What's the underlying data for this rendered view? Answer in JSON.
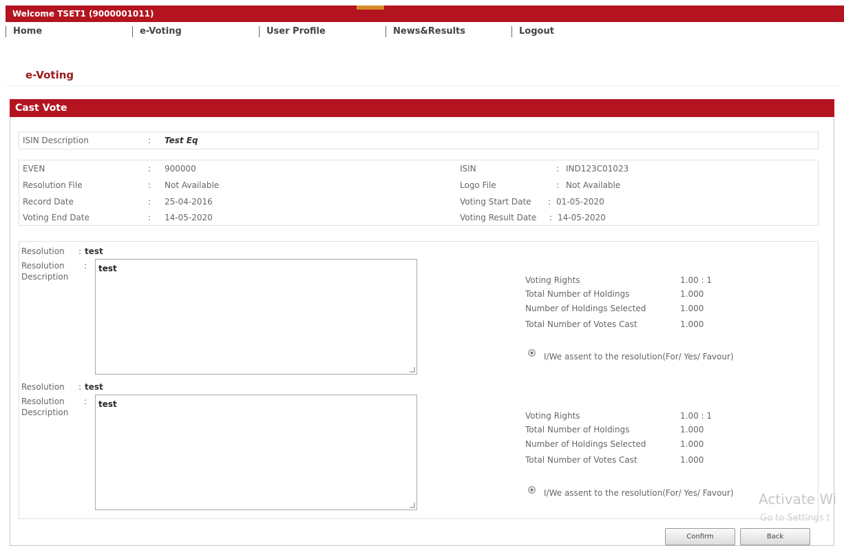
{
  "header": {
    "welcome": "Welcome TSET1 (9000001011)"
  },
  "nav": [
    "Home",
    "e-Voting",
    "User Profile",
    "News&Results",
    "Logout"
  ],
  "page_title": "e-Voting",
  "panel_title": "Cast Vote",
  "isin_description": {
    "label": "ISIN Description",
    "value": "Test Eq"
  },
  "details_left": [
    {
      "label": "EVEN",
      "value": "900000"
    },
    {
      "label": "Resolution File",
      "value": "Not Available"
    },
    {
      "label": "Record Date",
      "value": "25-04-2016"
    },
    {
      "label": "Voting End Date",
      "value": "14-05-2020"
    }
  ],
  "details_right": [
    {
      "label": "ISIN",
      "value": "IND123C01023"
    },
    {
      "label": "Logo File",
      "value": "Not Available"
    },
    {
      "label": "Voting Start Date",
      "value": "01-05-2020"
    },
    {
      "label": "Voting Result Date",
      "value": "14-05-2020"
    }
  ],
  "resolutions": [
    {
      "resolution_label": "Resolution",
      "resolution_value": "test",
      "description_label_1": "Resolution",
      "description_label_2": "Description",
      "description_value": "test",
      "stats": [
        {
          "label": "Voting Rights",
          "value": "1.00 : 1"
        },
        {
          "label": "Total Number of Holdings",
          "value": "1.000"
        },
        {
          "label": "Number of Holdings Selected",
          "value": "1.000"
        },
        {
          "label": "Total Number of Votes Cast",
          "value": "1.000"
        }
      ],
      "assent_label": "I/We assent to the resolution(For/ Yes/ Favour)"
    },
    {
      "resolution_label": "Resolution",
      "resolution_value": "test",
      "description_label_1": "Resolution",
      "description_label_2": "Description",
      "description_value": "test",
      "stats": [
        {
          "label": "Voting Rights",
          "value": "1.00 : 1"
        },
        {
          "label": "Total Number of Holdings",
          "value": "1.000"
        },
        {
          "label": "Number of Holdings Selected",
          "value": "1.000"
        },
        {
          "label": "Total Number of Votes Cast",
          "value": "1.000"
        }
      ],
      "assent_label": "I/We assent to the resolution(For/ Yes/ Favour)"
    }
  ],
  "buttons": {
    "confirm": "Confirm",
    "back": "Back"
  },
  "watermark": {
    "line1": "Activate Wi",
    "line2": "Go to Settings t"
  },
  "colors": {
    "brand": "#b3141f",
    "title": "#9a1b1b"
  }
}
